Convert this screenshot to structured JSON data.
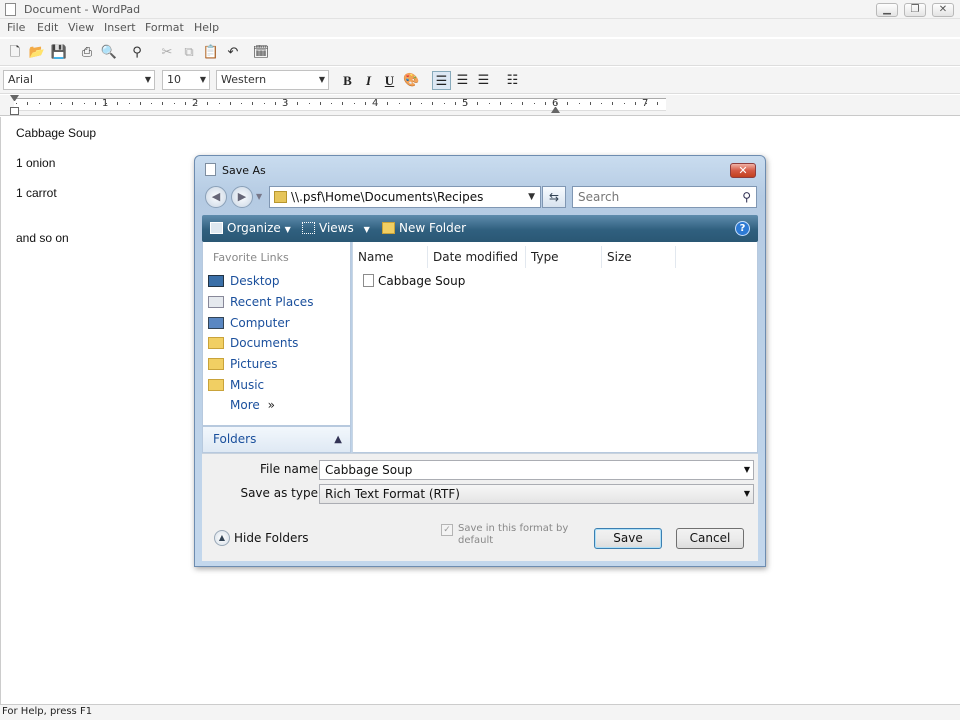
{
  "window": {
    "title": "Document - WordPad",
    "controls": {
      "minimize": "▁",
      "restore": "❐",
      "close": "✕"
    }
  },
  "menu": [
    "File",
    "Edit",
    "View",
    "Insert",
    "Format",
    "Help"
  ],
  "toolbar_icons": [
    "new-icon",
    "open-icon",
    "save-icon",
    "print-icon",
    "print-preview-icon",
    "find-icon",
    "cut-icon",
    "copy-icon",
    "paste-icon",
    "undo-icon",
    "date-time-icon"
  ],
  "format_bar": {
    "font": "Arial",
    "size": "10",
    "script": "Western",
    "bold": "B",
    "italic": "I",
    "underline": "U"
  },
  "ruler": {
    "numbers": [
      "1",
      "2",
      "3",
      "4",
      "5",
      "6",
      "7"
    ]
  },
  "document": {
    "lines": [
      "Cabbage Soup",
      "1 onion",
      "1 carrot",
      "and so on"
    ]
  },
  "status": "For Help, press F1",
  "dialog": {
    "title": "Save As",
    "close": "✕",
    "address": "\\\\.psf\\Home\\Documents\\Recipes",
    "search_placeholder": "Search",
    "commands": {
      "organize": "Organize",
      "views": "Views",
      "new_folder": "New Folder",
      "help": "?"
    },
    "favorite_links_heading": "Favorite Links",
    "favorite_links": [
      "Desktop",
      "Recent Places",
      "Computer",
      "Documents",
      "Pictures",
      "Music",
      "More"
    ],
    "more_glyph": "»",
    "folders_label": "Folders",
    "columns": [
      "Name",
      "Date modified",
      "Type",
      "Size"
    ],
    "files": [
      "Cabbage Soup"
    ],
    "file_name_label": "File name:",
    "file_name_value": "Cabbage Soup",
    "save_as_type_label": "Save as type:",
    "save_as_type_value": "Rich Text Format (RTF)",
    "checkbox_label": "Save in this format by default",
    "save_button": "Save",
    "cancel_button": "Cancel",
    "hide_folders": "Hide Folders"
  },
  "colors": {
    "command_bar": "#30607f",
    "link": "#1a4f9c",
    "close_button": "#c2401e"
  }
}
